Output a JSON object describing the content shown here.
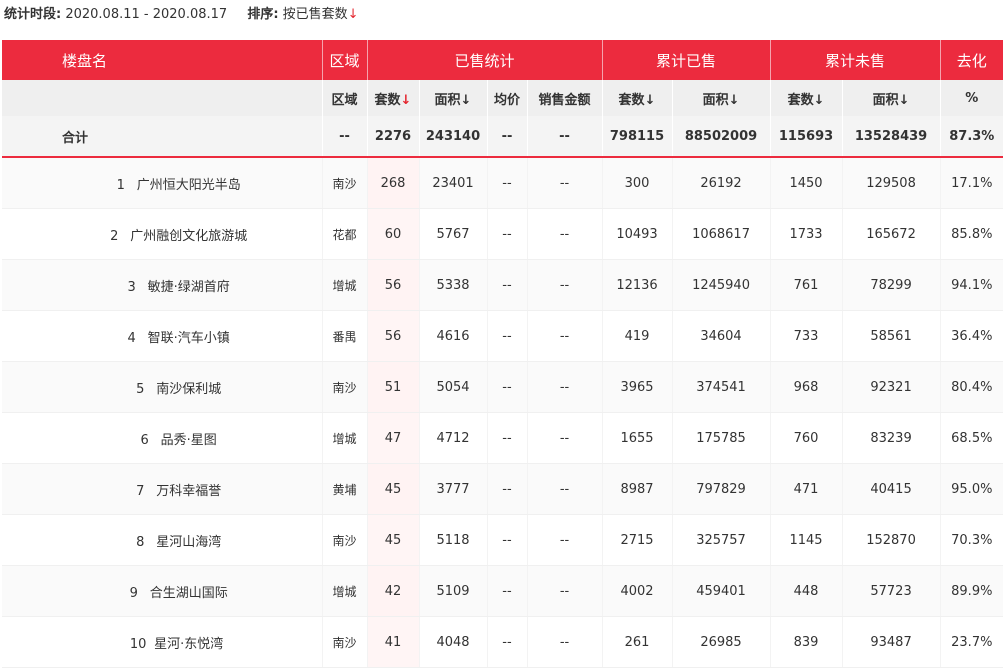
{
  "filter": {
    "period_label": "统计时段:",
    "period_value": "2020.08.11 - 2020.08.17",
    "sort_label": "排序:",
    "sort_value": "按已售套数",
    "sort_arrow": "↓"
  },
  "header": {
    "group": {
      "name": "楼盘名",
      "district": "区域",
      "sold": "已售统计",
      "cum_sold": "累计已售",
      "cum_unsold": "累计未售",
      "rate": "去化"
    },
    "sub": {
      "district": "区域",
      "units": "套数",
      "area": "面积",
      "avg_price": "均价",
      "sales_amount": "销售金额",
      "cum_units": "套数",
      "cum_area": "面积",
      "unsold_units": "套数",
      "unsold_area": "面积",
      "rate_unit": "%"
    },
    "arrow": "↓"
  },
  "total": {
    "label": "合计",
    "district": "--",
    "units": "2276",
    "area": "243140",
    "avg_price": "--",
    "sales_amount": "--",
    "cum_units": "798115",
    "cum_area": "88502009",
    "unsold_units": "115693",
    "unsold_area": "13528439",
    "rate": "87.3%"
  },
  "rows": [
    {
      "idx": "1",
      "name": "广州恒大阳光半岛",
      "district": "南沙",
      "units": "268",
      "area": "23401",
      "avg_price": "--",
      "sales_amount": "--",
      "cum_units": "300",
      "cum_area": "26192",
      "unsold_units": "1450",
      "unsold_area": "129508",
      "rate": "17.1%"
    },
    {
      "idx": "2",
      "name": "广州融创文化旅游城",
      "district": "花都",
      "units": "60",
      "area": "5767",
      "avg_price": "--",
      "sales_amount": "--",
      "cum_units": "10493",
      "cum_area": "1068617",
      "unsold_units": "1733",
      "unsold_area": "165672",
      "rate": "85.8%"
    },
    {
      "idx": "3",
      "name": "敏捷·绿湖首府",
      "district": "增城",
      "units": "56",
      "area": "5338",
      "avg_price": "--",
      "sales_amount": "--",
      "cum_units": "12136",
      "cum_area": "1245940",
      "unsold_units": "761",
      "unsold_area": "78299",
      "rate": "94.1%"
    },
    {
      "idx": "4",
      "name": "智联·汽车小镇",
      "district": "番禺",
      "units": "56",
      "area": "4616",
      "avg_price": "--",
      "sales_amount": "--",
      "cum_units": "419",
      "cum_area": "34604",
      "unsold_units": "733",
      "unsold_area": "58561",
      "rate": "36.4%"
    },
    {
      "idx": "5",
      "name": "南沙保利城",
      "district": "南沙",
      "units": "51",
      "area": "5054",
      "avg_price": "--",
      "sales_amount": "--",
      "cum_units": "3965",
      "cum_area": "374541",
      "unsold_units": "968",
      "unsold_area": "92321",
      "rate": "80.4%"
    },
    {
      "idx": "6",
      "name": "品秀·星图",
      "district": "增城",
      "units": "47",
      "area": "4712",
      "avg_price": "--",
      "sales_amount": "--",
      "cum_units": "1655",
      "cum_area": "175785",
      "unsold_units": "760",
      "unsold_area": "83239",
      "rate": "68.5%"
    },
    {
      "idx": "7",
      "name": "万科幸福誉",
      "district": "黄埔",
      "units": "45",
      "area": "3777",
      "avg_price": "--",
      "sales_amount": "--",
      "cum_units": "8987",
      "cum_area": "797829",
      "unsold_units": "471",
      "unsold_area": "40415",
      "rate": "95.0%"
    },
    {
      "idx": "8",
      "name": "星河山海湾",
      "district": "南沙",
      "units": "45",
      "area": "5118",
      "avg_price": "--",
      "sales_amount": "--",
      "cum_units": "2715",
      "cum_area": "325757",
      "unsold_units": "1145",
      "unsold_area": "152870",
      "rate": "70.3%"
    },
    {
      "idx": "9",
      "name": "合生湖山国际",
      "district": "增城",
      "units": "42",
      "area": "5109",
      "avg_price": "--",
      "sales_amount": "--",
      "cum_units": "4002",
      "cum_area": "459401",
      "unsold_units": "448",
      "unsold_area": "57723",
      "rate": "89.9%"
    },
    {
      "idx": "10",
      "name": "星河·东悦湾",
      "district": "南沙",
      "units": "41",
      "area": "4048",
      "avg_price": "--",
      "sales_amount": "--",
      "cum_units": "261",
      "cum_area": "26985",
      "unsold_units": "839",
      "unsold_area": "93487",
      "rate": "23.7%"
    }
  ],
  "colors": {
    "accent": "#ec2b3e",
    "sort_arrow": "#e4262f",
    "header_sub_bg": "#efefef"
  }
}
